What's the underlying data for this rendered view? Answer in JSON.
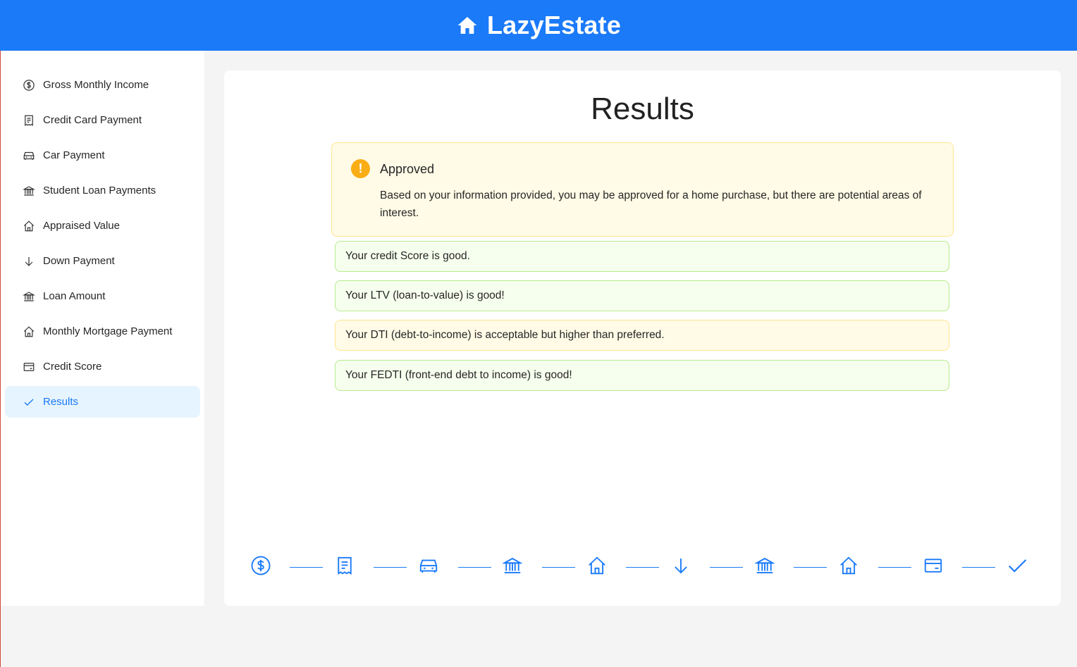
{
  "app": {
    "title": "LazyEstate",
    "logo_icon": "home-icon"
  },
  "colors": {
    "primary": "#1a7af8",
    "success_bg": "#f6ffed",
    "success_border": "#b7eb8f",
    "warning_bg": "#fffbe6",
    "warning_border": "#ffe58f",
    "warning_icon": "#faad14"
  },
  "sidebar": {
    "items": [
      {
        "label": "Gross Monthly Income",
        "icon": "dollar-circle-icon"
      },
      {
        "label": "Credit Card Payment",
        "icon": "receipt-icon"
      },
      {
        "label": "Car Payment",
        "icon": "car-icon"
      },
      {
        "label": "Student Loan Payments",
        "icon": "bank-icon"
      },
      {
        "label": "Appraised Value",
        "icon": "home-outline-icon"
      },
      {
        "label": "Down Payment",
        "icon": "arrow-down-icon"
      },
      {
        "label": "Loan Amount",
        "icon": "bank-icon"
      },
      {
        "label": "Monthly Mortgage Payment",
        "icon": "home-outline-icon"
      },
      {
        "label": "Credit Score",
        "icon": "credit-card-icon"
      },
      {
        "label": "Results",
        "icon": "check-icon",
        "active": true
      }
    ]
  },
  "main": {
    "title": "Results",
    "alert": {
      "title": "Approved",
      "description": "Based on your information provided, you may be approved for a home purchase, but there are potential areas of interest."
    },
    "messages": [
      {
        "text": "Your credit Score is good.",
        "status": "success"
      },
      {
        "text": "Your LTV (loan-to-value) is good!",
        "status": "success"
      },
      {
        "text": "Your DTI (debt-to-income) is acceptable but higher than preferred.",
        "status": "warning"
      },
      {
        "text": "Your FEDTI (front-end debt to income) is good!",
        "status": "success"
      }
    ]
  },
  "steps": [
    "dollar-circle-icon",
    "receipt-icon",
    "car-icon",
    "bank-icon",
    "home-outline-icon",
    "arrow-down-icon",
    "bank-icon",
    "home-outline-icon",
    "credit-card-icon",
    "check-icon"
  ]
}
